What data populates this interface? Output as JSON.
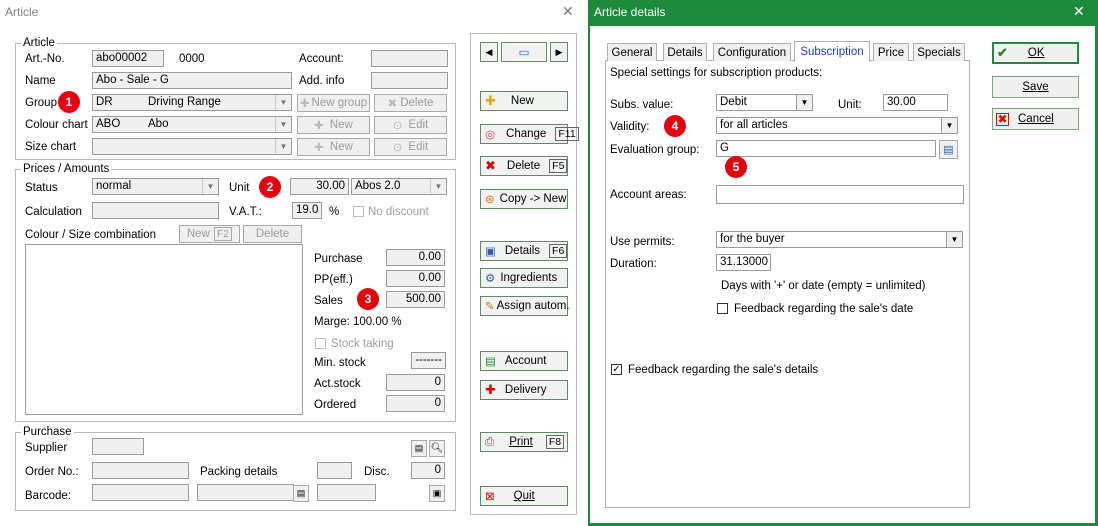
{
  "article_window": {
    "title": "Article",
    "close": "✕",
    "article_group": {
      "title": "Article",
      "art_no_label": "Art.-No.",
      "art_no": "abo00002",
      "art_no_suffix": "0000",
      "account_label": "Account:",
      "name_label": "Name",
      "name": "Abo - Sale - G",
      "add_info_label": "Add. info",
      "group_label": "Group",
      "group_code": "DR",
      "group_name": "Driving Range",
      "new_group": "New group",
      "delete": "Delete",
      "colour_label": "Colour chart",
      "colour_code": "ABO",
      "colour_name": "Abo",
      "new": "New",
      "edit": "Edit",
      "size_label": "Size chart"
    },
    "prices_group": {
      "title": "Prices / Amounts",
      "status_label": "Status",
      "status": "normal",
      "unit_label": "Unit",
      "unit_value": "30.00",
      "unit_name": "Abos 2.0",
      "calc_label": "Calculation",
      "vat_label": "V.A.T.:",
      "vat": "19.0",
      "pct": "%",
      "no_discount": "No discount",
      "combo_label": "Colour / Size combination",
      "new_f2": "New",
      "f2": "F2",
      "delete": "Delete",
      "purchase_label": "Purchase",
      "purchase": "0.00",
      "pp_label": "PP(eff.)",
      "pp": "0.00",
      "sales_label": "Sales",
      "sales": "500.00",
      "marge": "Marge: 100.00 %",
      "stock_taking": "Stock taking",
      "min_stock_label": "Min. stock",
      "min_stock": "-------",
      "act_stock_label": "Act.stock",
      "act_stock": "0",
      "ordered_label": "Ordered",
      "ordered": "0"
    },
    "purchase_group": {
      "title": "Purchase",
      "supplier_label": "Supplier",
      "order_label": "Order No.:",
      "packing_label": "Packing details",
      "disc_label": "Disc.",
      "disc": "0",
      "barcode_label": "Barcode:"
    },
    "side_buttons": [
      {
        "label": "New",
        "key": "",
        "icon": "plus-icon"
      },
      {
        "label": "Change",
        "key": "F11",
        "icon": "change-icon"
      },
      {
        "label": "Delete",
        "key": "F5",
        "icon": "delete-x-icon"
      },
      {
        "label": "Copy -> New",
        "key": "",
        "icon": "copy-icon"
      },
      {
        "label": "Details",
        "key": "F6",
        "icon": "details-icon"
      },
      {
        "label": "Ingredients",
        "key": "",
        "icon": "ingredients-icon"
      },
      {
        "label": "Assign autom.",
        "key": "",
        "icon": "assign-icon"
      },
      {
        "label": "Account",
        "key": "",
        "icon": "account-icon"
      },
      {
        "label": "Delivery",
        "key": "",
        "icon": "delivery-icon"
      },
      {
        "label": "Print",
        "key": "F8",
        "icon": "printer-icon"
      },
      {
        "label": "Quit",
        "key": "",
        "icon": "quit-icon"
      }
    ]
  },
  "details_window": {
    "title": "Article details",
    "close": "✕",
    "tabs": [
      "General",
      "Details",
      "Configuration",
      "Subscription",
      "Price",
      "Specials"
    ],
    "active_tab": "Subscription",
    "intro": "Special settings for subscription products:",
    "subs_value_label": "Subs. value:",
    "subs_value": "Debit",
    "unit_label": "Unit:",
    "unit": "30.00",
    "validity_label": "Validity:",
    "validity": "for all articles",
    "eval_label": "Evaluation group:",
    "eval": "G",
    "account_areas_label": "Account areas:",
    "use_permits_label": "Use permits:",
    "use_permits": "for the buyer",
    "duration_label": "Duration:",
    "duration": "31.13000",
    "duration_hint": "Days with '+' or date (empty = unlimited)",
    "feedback_date": "Feedback regarding the sale's date",
    "feedback_details": "Feedback regarding the sale's details",
    "ok": "OK",
    "save": "Save",
    "cancel": "Cancel"
  },
  "badges": [
    "1",
    "2",
    "3",
    "4",
    "5"
  ],
  "colors": {
    "green_frame": "#1e8a3c",
    "badge": "#e3000f",
    "tab_active": "#1c3cbe"
  }
}
